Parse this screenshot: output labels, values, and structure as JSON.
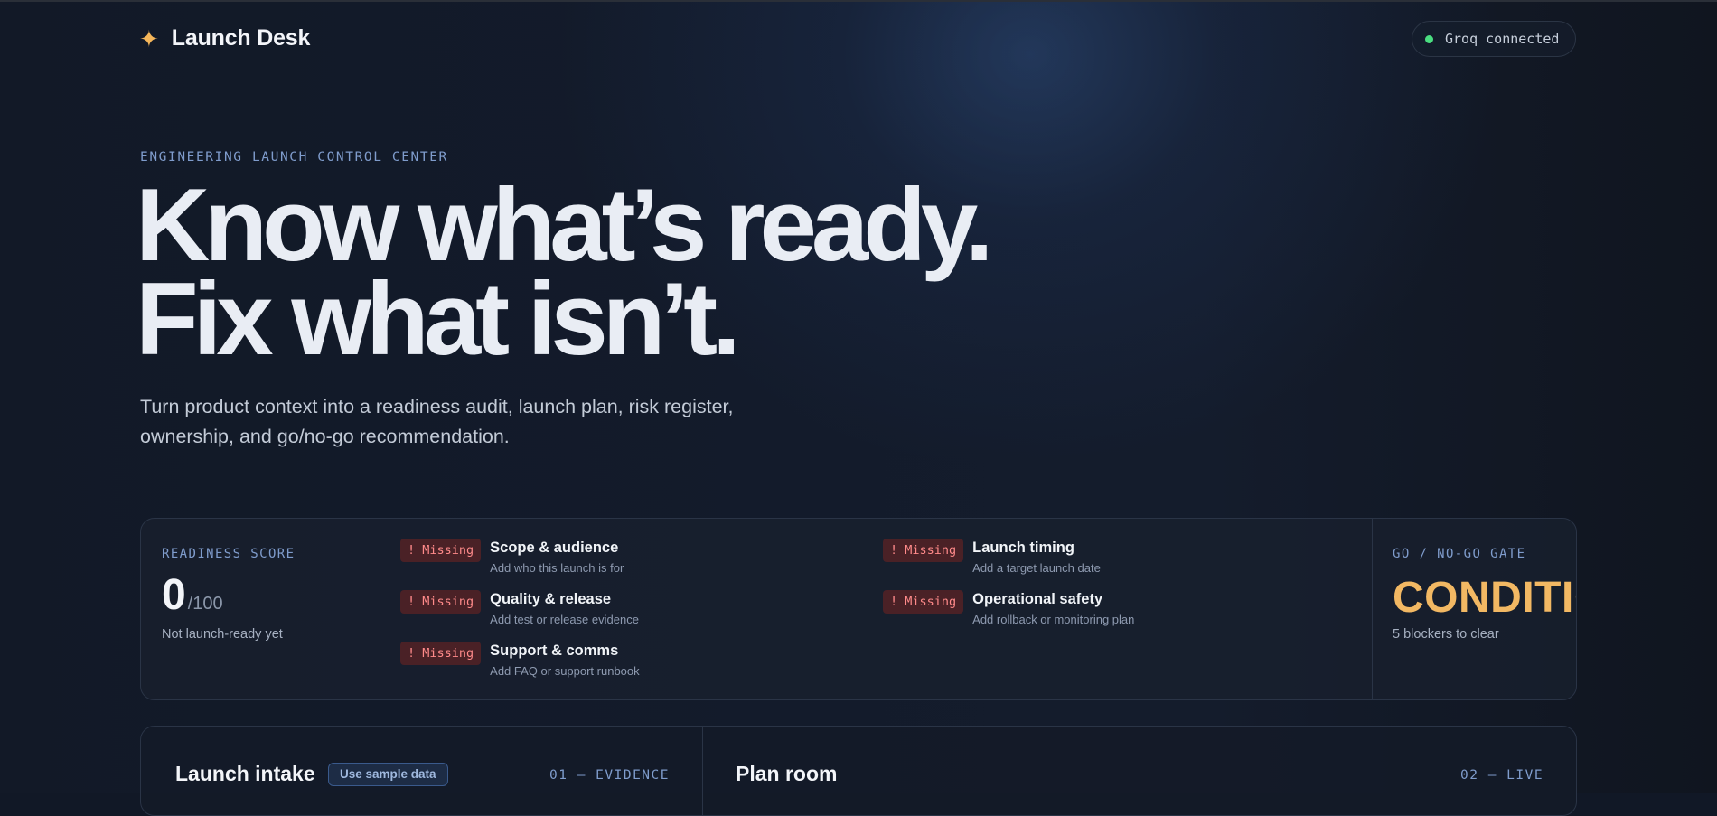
{
  "header": {
    "brand_icon": "sparkle-icon",
    "brand_name": "Launch Desk",
    "status": {
      "text": "Groq connected",
      "color": "#4ade80"
    }
  },
  "hero": {
    "eyebrow": "ENGINEERING LAUNCH CONTROL CENTER",
    "title_line1": "Know what’s ready.",
    "title_line2": "Fix what isn’t.",
    "subtitle": "Turn product context into a readiness audit, launch plan, risk register, ownership, and go/no-go recommendation."
  },
  "readiness": {
    "label": "READINESS SCORE",
    "score": "0",
    "score_max": "/100",
    "note": "Not launch-ready yet",
    "checks": [
      {
        "badge": "! Missing",
        "title": "Scope & audience",
        "desc": "Add who this launch is for"
      },
      {
        "badge": "! Missing",
        "title": "Quality & release",
        "desc": "Add test or release evidence"
      },
      {
        "badge": "! Missing",
        "title": "Support & comms",
        "desc": "Add FAQ or support runbook"
      },
      {
        "badge": "! Missing",
        "title": "Launch timing",
        "desc": "Add a target launch date"
      },
      {
        "badge": "! Missing",
        "title": "Operational safety",
        "desc": "Add rollback or monitoring plan"
      }
    ],
    "gate": {
      "label": "GO / NO-GO GATE",
      "value": "CONDITIONAL",
      "note": "5 blockers to clear",
      "color": "#f2b863"
    }
  },
  "intake": {
    "title": "Launch intake",
    "sample_button": "Use sample data",
    "tag": "01 — EVIDENCE"
  },
  "plan": {
    "title": "Plan room",
    "tag": "02 — LIVE"
  },
  "colors": {
    "background": "#111826",
    "accent": "#7f9ccc",
    "missing_badge_bg": "#4a2126",
    "missing_badge_text": "#ff8a8a",
    "brand_icon": "#f5b65a"
  }
}
